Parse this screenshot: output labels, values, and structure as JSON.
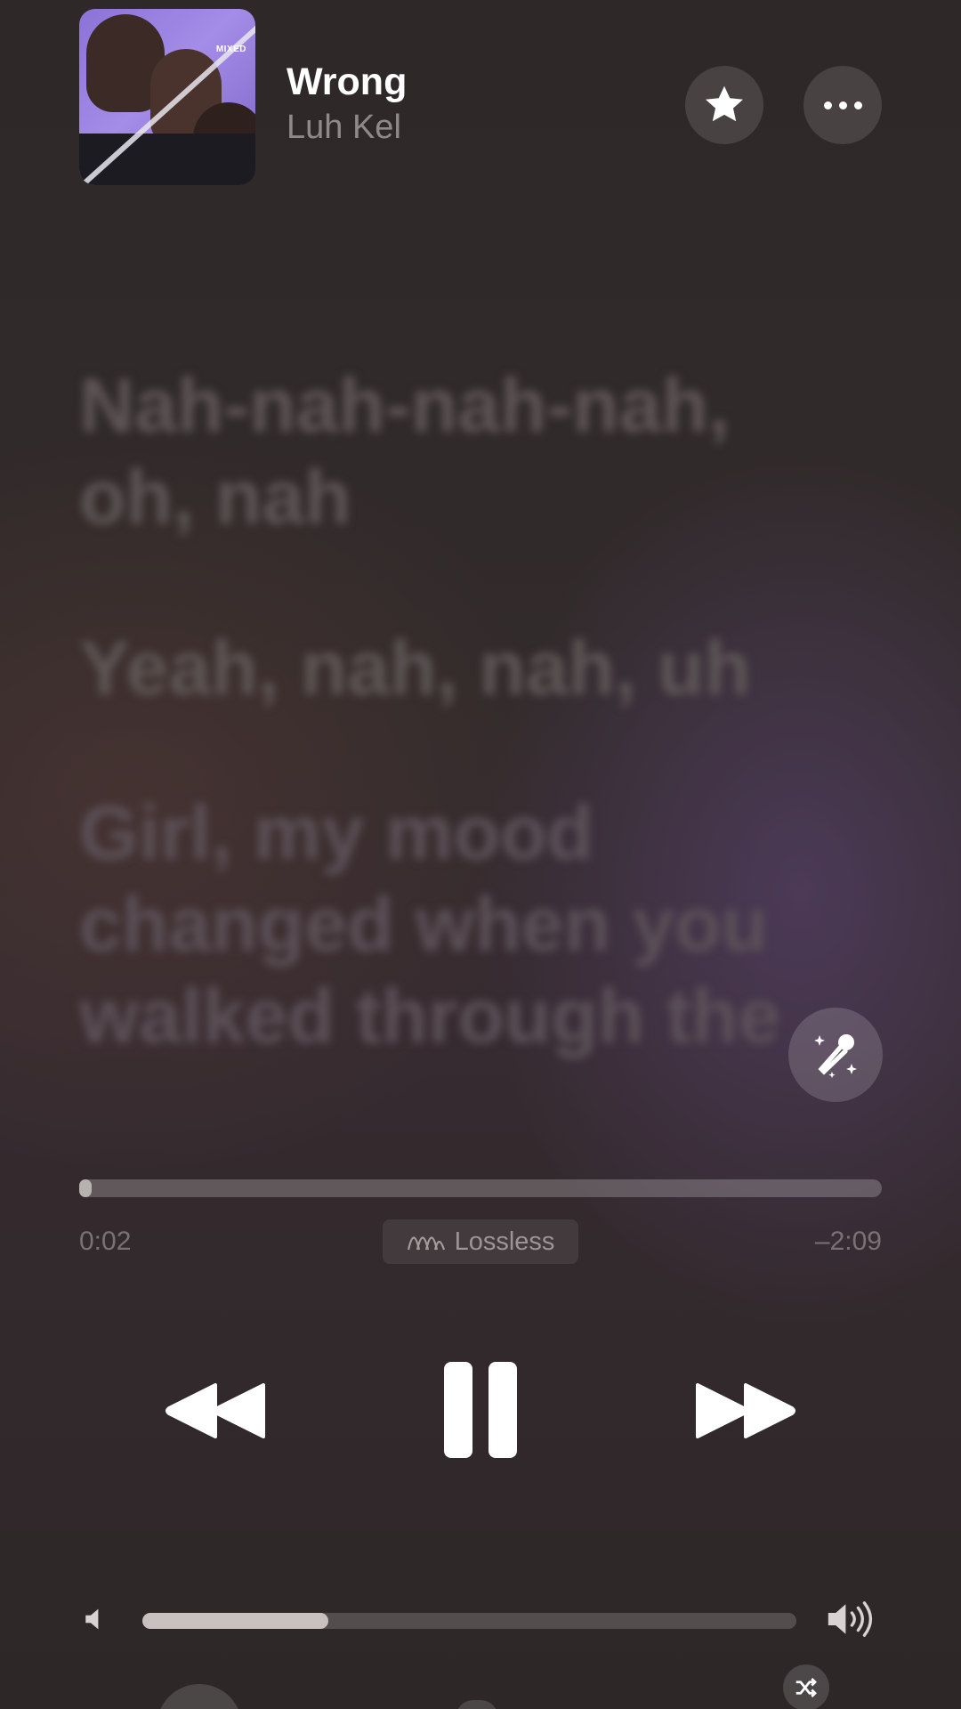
{
  "now_playing": {
    "title": "Wrong",
    "artist": "Luh Kel",
    "album_art_badge": "MIXED"
  },
  "actions": {
    "favorite_icon": "star-icon",
    "more_icon": "ellipsis-icon",
    "sing_icon": "microphone-sparkle-icon"
  },
  "lyrics": {
    "lines": [
      "Nah-nah-nah-nah, oh, nah",
      "Yeah, nah, nah, uh",
      "Girl, my mood changed when you walked through the"
    ]
  },
  "playback": {
    "elapsed": "0:02",
    "remaining": "–2:09",
    "progress_fraction": 0.015,
    "quality_label": "Lossless",
    "quality_icon": "lossless-wave-icon"
  },
  "controls": {
    "rewind_icon": "rewind-icon",
    "pause_icon": "pause-icon",
    "forward_icon": "fast-forward-icon",
    "shuffle_icon": "shuffle-icon"
  },
  "volume": {
    "level_fraction": 0.285,
    "low_icon": "volume-low-icon",
    "high_icon": "volume-high-icon"
  },
  "colors": {
    "album_purple": "#9a82e0",
    "text_secondary": "#8f8a8a"
  }
}
